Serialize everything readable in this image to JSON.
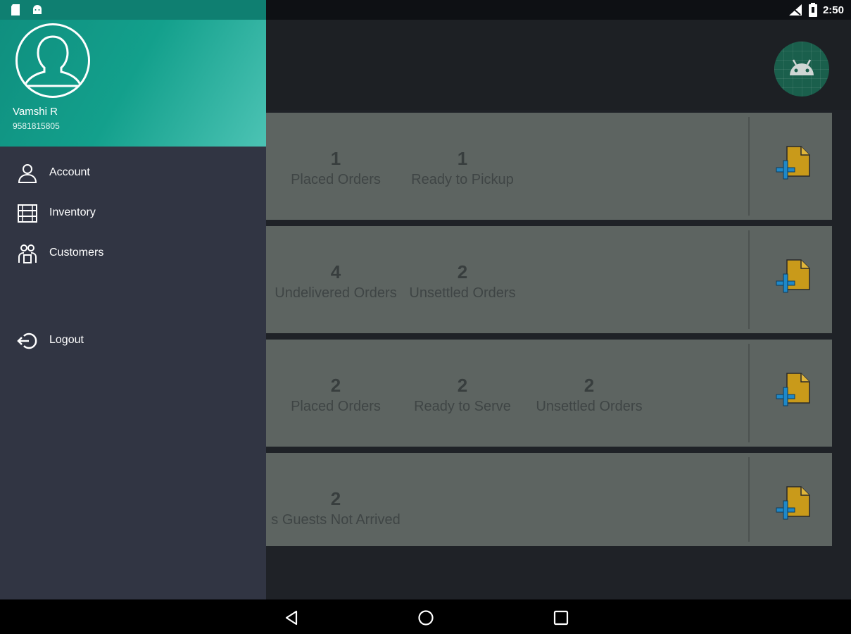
{
  "status_bar": {
    "time": "2:50",
    "icons": [
      "sd-card-icon",
      "android-debug-icon",
      "signal-icon",
      "battery-icon"
    ]
  },
  "drawer": {
    "user": {
      "name": "Vamshi R",
      "phone": "9581815805"
    },
    "menu": [
      {
        "label": "Account",
        "icon": "account-icon"
      },
      {
        "label": "Inventory",
        "icon": "inventory-icon"
      },
      {
        "label": "Customers",
        "icon": "customers-icon"
      },
      {
        "label": "Logout",
        "icon": "logout-icon"
      }
    ]
  },
  "cards": [
    {
      "stats": [
        {
          "value": "1",
          "label": "Placed Orders"
        },
        {
          "value": "1",
          "label": "Ready to Pickup"
        }
      ]
    },
    {
      "stats": [
        {
          "value": "4",
          "label": "Undelivered Orders"
        },
        {
          "value": "2",
          "label": "Unsettled Orders"
        }
      ]
    },
    {
      "stats": [
        {
          "value": "2",
          "label": "Placed Orders"
        },
        {
          "value": "2",
          "label": "Ready to Serve"
        },
        {
          "value": "2",
          "label": "Unsettled Orders"
        }
      ]
    },
    {
      "stats": [
        {
          "value": "2",
          "label": "s Guests Not Arrived"
        }
      ]
    }
  ],
  "colors": {
    "drawer_header": "#13a08c",
    "drawer_bg": "#313543",
    "card_bg": "#5d6461",
    "add_icon_doc": "#c99a1a",
    "add_icon_plus": "#1e88c8"
  }
}
